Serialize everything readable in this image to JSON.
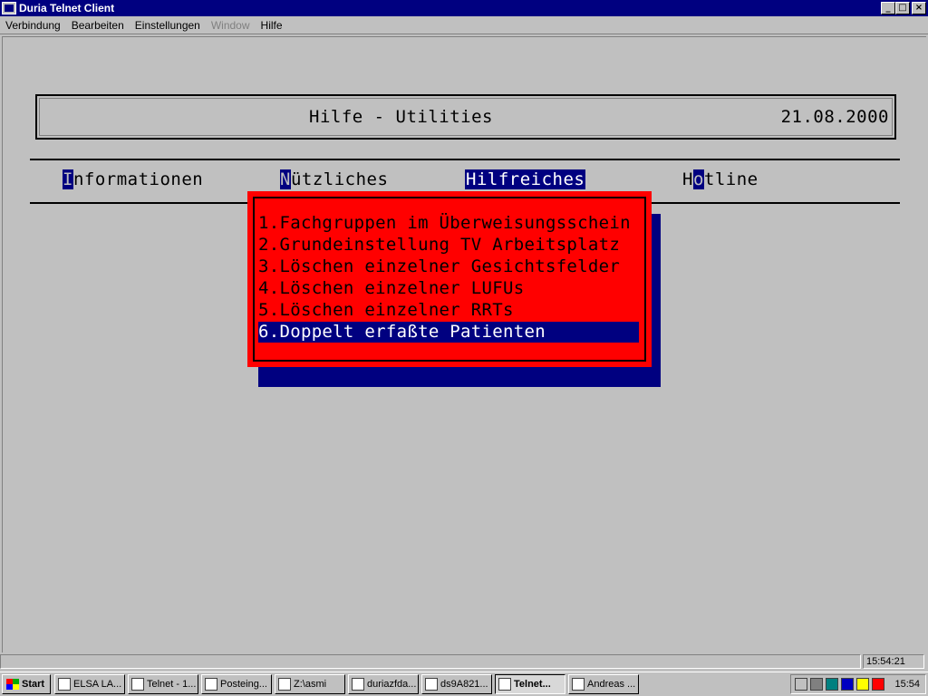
{
  "window": {
    "title": "Duria Telnet Client",
    "buttons": {
      "minimize": "_",
      "maximize": "□",
      "close": "×"
    }
  },
  "menubar": {
    "items": [
      {
        "label": "Verbindung",
        "disabled": false
      },
      {
        "label": "Bearbeiten",
        "disabled": false
      },
      {
        "label": "Einstellungen",
        "disabled": false
      },
      {
        "label": "Window",
        "disabled": true
      },
      {
        "label": "Hilfe",
        "disabled": false
      }
    ]
  },
  "screen": {
    "header_title": "Hilfe - Utilities",
    "header_date": "21.08.2000",
    "tabs": [
      {
        "hot": "I",
        "rest": "nformationen",
        "active": false
      },
      {
        "hot": "N",
        "rest": "ützliches",
        "active": false
      },
      {
        "label": "Hilfreiches",
        "active": true
      },
      {
        "pre": "H",
        "hot": "o",
        "rest": "tline",
        "active": false
      }
    ],
    "menu_entries": [
      "1.Fachgruppen im Überweisungsschein",
      "2.Grundeinstellung TV Arbeitsplatz",
      "3.Löschen einzelner Gesichtsfelder",
      "4.Löschen einzelner LUFUs",
      "5.Löschen einzelner RRTs",
      "6.Doppelt erfaßte Patienten"
    ],
    "selected_index": 5
  },
  "statusbar": {
    "main": "",
    "time": "15:54:21"
  },
  "taskbar": {
    "start_label": "Start",
    "tasks": [
      {
        "label": "ELSA LA...",
        "active": false
      },
      {
        "label": "Telnet - 1...",
        "active": false
      },
      {
        "label": "Posteing...",
        "active": false
      },
      {
        "label": "Z:\\asmi",
        "active": false
      },
      {
        "label": "duriazfda...",
        "active": false
      },
      {
        "label": "ds9A821...",
        "active": false
      },
      {
        "label": "Telnet...",
        "active": true
      },
      {
        "label": "Andreas ...",
        "active": false
      }
    ],
    "clock": "15:54"
  },
  "colors": {
    "titlebar": "#000080",
    "menu_bg": "#ff0000",
    "selection": "#000080",
    "surface": "#c0c0c0"
  }
}
